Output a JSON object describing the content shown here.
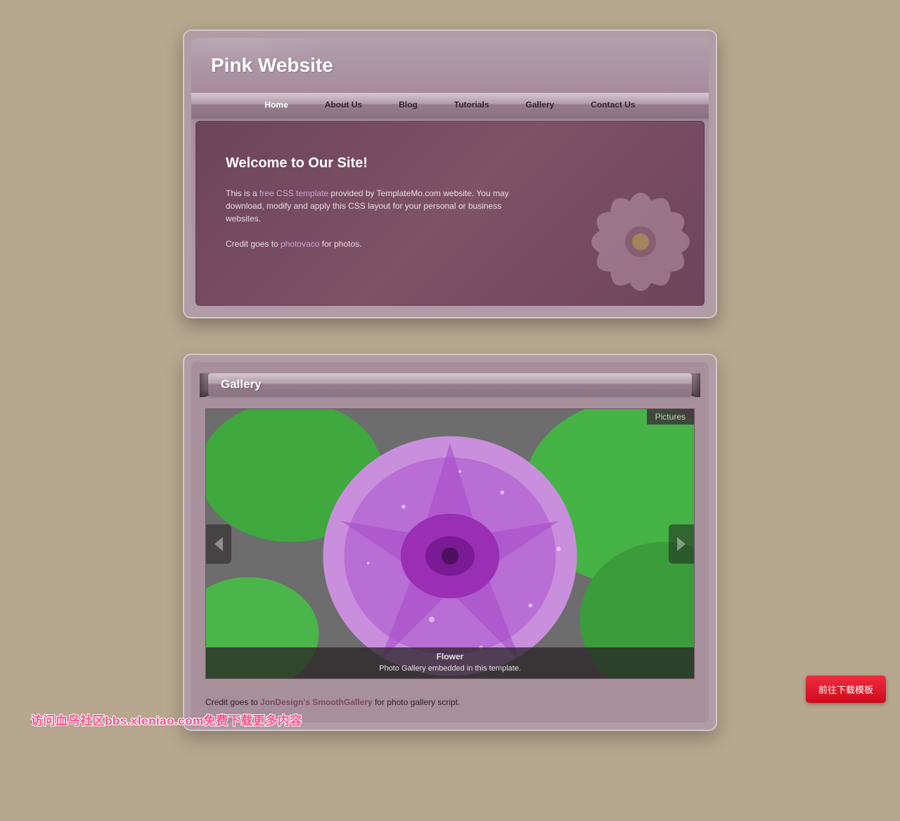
{
  "site": {
    "title": "Pink Website"
  },
  "nav": {
    "items": [
      {
        "label": "Home",
        "current": true
      },
      {
        "label": "About Us"
      },
      {
        "label": "Blog"
      },
      {
        "label": "Tutorials"
      },
      {
        "label": "Gallery"
      },
      {
        "label": "Contact Us"
      }
    ]
  },
  "hero": {
    "heading": "Welcome to Our Site!",
    "p1_a": "This is a ",
    "p1_link": "free CSS template",
    "p1_b": " provided by TemplateMo.com website. You may download, modify and apply this CSS layout for your personal or business websites.",
    "p2_a": "Credit goes to ",
    "p2_link": "photovaco",
    "p2_b": " for photos."
  },
  "section": {
    "title": "Gallery"
  },
  "gallery": {
    "tab": "Pictures",
    "caption_title": "Flower",
    "caption_desc": "Photo Gallery embedded in this template."
  },
  "credit": {
    "a": "Credit goes to ",
    "link": "JonDesign's SmoothGallery",
    "b": " for photo gallery script."
  },
  "download_btn": "前往下载模板",
  "watermark": "访问血鸟社区bbs.xleniao.com免费下载更多内容"
}
